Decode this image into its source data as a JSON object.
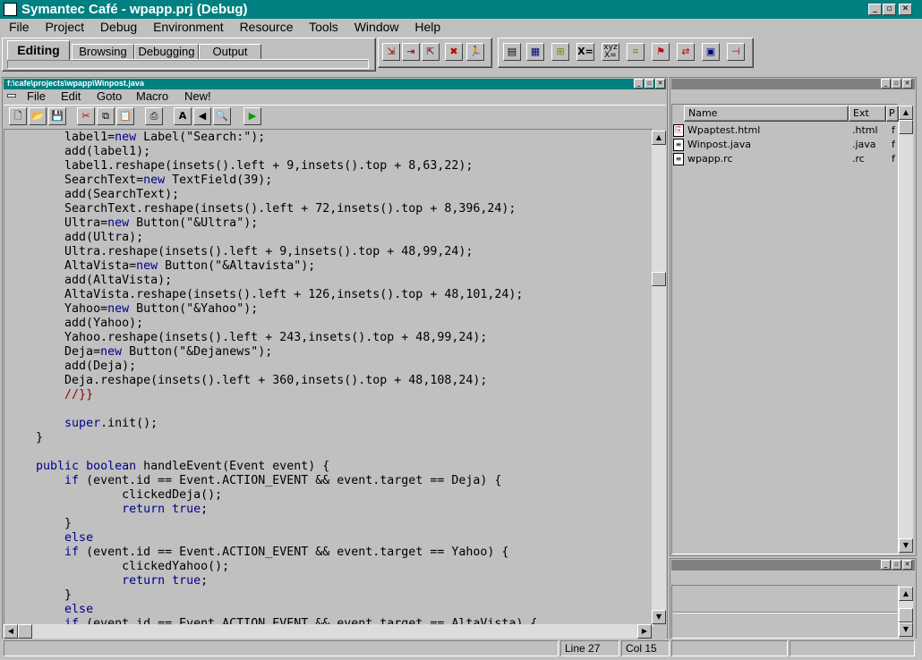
{
  "app": {
    "title": "Symantec Café - wpapp.prj (Debug)",
    "menu": [
      "File",
      "Project",
      "Debug",
      "Environment",
      "Resource",
      "Tools",
      "Window",
      "Help"
    ]
  },
  "tabs": [
    "Editing",
    "Browsing",
    "Debugging",
    "Output"
  ],
  "editor": {
    "title": "f:\\cafe\\projects\\wpapp\\Winpost.java",
    "menu": [
      "File",
      "Edit",
      "Goto",
      "Macro",
      "New!"
    ],
    "code": [
      [
        [
          "        label1=",
          ""
        ],
        [
          "new",
          "kw"
        ],
        [
          " Label(\"Search:\");",
          ""
        ]
      ],
      [
        [
          "        add(label1);",
          ""
        ]
      ],
      [
        [
          "        label1.reshape(insets().left + 9,insets().top + 8,63,22);",
          ""
        ]
      ],
      [
        [
          "        SearchText=",
          ""
        ],
        [
          "new",
          "kw"
        ],
        [
          " TextField(39);",
          ""
        ]
      ],
      [
        [
          "        add(SearchText);",
          ""
        ]
      ],
      [
        [
          "        SearchText.reshape(insets().left + 72,insets().top + 8,396,24);",
          ""
        ]
      ],
      [
        [
          "        Ultra=",
          ""
        ],
        [
          "new",
          "kw"
        ],
        [
          " Button(\"&Ultra\");",
          ""
        ]
      ],
      [
        [
          "        add(Ultra);",
          ""
        ]
      ],
      [
        [
          "        Ultra.reshape(insets().left + 9,insets().top + 48,99,24);",
          ""
        ]
      ],
      [
        [
          "        AltaVista=",
          ""
        ],
        [
          "new",
          "kw"
        ],
        [
          " Button(\"&Altavista\");",
          ""
        ]
      ],
      [
        [
          "        add(AltaVista);",
          ""
        ]
      ],
      [
        [
          "        AltaVista.reshape(insets().left + 126,insets().top + 48,101,24);",
          ""
        ]
      ],
      [
        [
          "        Yahoo=",
          ""
        ],
        [
          "new",
          "kw"
        ],
        [
          " Button(\"&Yahoo\");",
          ""
        ]
      ],
      [
        [
          "        add(Yahoo);",
          ""
        ]
      ],
      [
        [
          "        Yahoo.reshape(insets().left + 243,insets().top + 48,99,24);",
          ""
        ]
      ],
      [
        [
          "        Deja=",
          ""
        ],
        [
          "new",
          "kw"
        ],
        [
          " Button(\"&Dejanews\");",
          ""
        ]
      ],
      [
        [
          "        add(Deja);",
          ""
        ]
      ],
      [
        [
          "        Deja.reshape(insets().left + 360,insets().top + 48,108,24);",
          ""
        ]
      ],
      [
        [
          "        ",
          ""
        ],
        [
          "//}}",
          "cm"
        ]
      ],
      [
        [
          "",
          ""
        ]
      ],
      [
        [
          "        ",
          ""
        ],
        [
          "super",
          "kw"
        ],
        [
          ".init();",
          ""
        ]
      ],
      [
        [
          "    }",
          ""
        ]
      ],
      [
        [
          "",
          ""
        ]
      ],
      [
        [
          "    ",
          ""
        ],
        [
          "public boolean",
          "kw"
        ],
        [
          " handleEvent(Event event) {",
          ""
        ]
      ],
      [
        [
          "        ",
          ""
        ],
        [
          "if",
          "kw"
        ],
        [
          " (event.id == Event.ACTION_EVENT && event.target == Deja) {",
          ""
        ]
      ],
      [
        [
          "                clickedDeja();",
          ""
        ]
      ],
      [
        [
          "                ",
          ""
        ],
        [
          "return true",
          "kw"
        ],
        [
          ";",
          ""
        ]
      ],
      [
        [
          "        }",
          ""
        ]
      ],
      [
        [
          "        ",
          ""
        ],
        [
          "else",
          "kw"
        ]
      ],
      [
        [
          "        ",
          ""
        ],
        [
          "if",
          "kw"
        ],
        [
          " (event.id == Event.ACTION_EVENT && event.target == Yahoo) {",
          ""
        ]
      ],
      [
        [
          "                clickedYahoo();",
          ""
        ]
      ],
      [
        [
          "                ",
          ""
        ],
        [
          "return true",
          "kw"
        ],
        [
          ";",
          ""
        ]
      ],
      [
        [
          "        }",
          ""
        ]
      ],
      [
        [
          "        ",
          ""
        ],
        [
          "else",
          "kw"
        ]
      ],
      [
        [
          "        ",
          ""
        ],
        [
          "if",
          "kw"
        ],
        [
          " (event.id == Event.ACTION_EVENT && event.target == AltaVista) {",
          ""
        ]
      ]
    ]
  },
  "project": {
    "columns": [
      "Name",
      "Ext",
      "P"
    ],
    "files": [
      {
        "name": "Wpaptest.html",
        "ext": ".html",
        "p": "f",
        "icon": "html-file-icon"
      },
      {
        "name": "Winpost.java",
        "ext": ".java",
        "p": "f",
        "icon": "java-file-icon"
      },
      {
        "name": "wpapp.rc",
        "ext": ".rc",
        "p": "f",
        "icon": "rc-file-icon"
      }
    ]
  },
  "status": {
    "line": "Line 27",
    "col": "Col 15"
  }
}
